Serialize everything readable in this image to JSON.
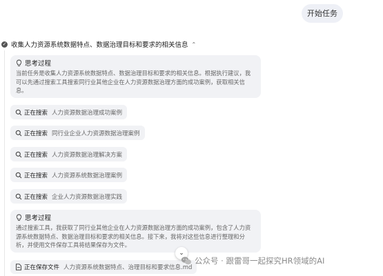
{
  "user_message": "开始任务",
  "task": {
    "title": "收集人力资源系统数据特点、数据治理目标和要求的相关信息"
  },
  "thinking_label": "思考过程",
  "thoughts": [
    "当前任务是收集人力资源系统数据特点、数据治理目标和要求的相关信息。根据执行建议，我可以先通过搜索工具搜索同行业其他企业在人力资源数据治理方面的成功案例，获取相关信息。",
    "通过搜索工具，我获取了同行业其他企业在人力资源数据治理方面的成功案例，包含了人力资源系统数据特点、数据治理目标和要求的相关信息。接下来，我将对这些信息进行整理和分析，并使用文件保存工具将结果保存为文件。"
  ],
  "searching_label": "正在搜索",
  "searches": [
    "人力资源数据治理成功案例",
    "同行业企业人力资源数据治理案例",
    "人力资源数据治理解决方案",
    "人力资源系统数据治理案例",
    "企业人力资源数据治理实践"
  ],
  "file_action": {
    "label": "正在保存文件",
    "filename": "人力资源系统数据特点、治理目标和要求信息.md"
  },
  "watermark": "公众号 · 跟雷哥一起探究HR领域的AI",
  "icons": {
    "check": "check-circle-icon",
    "collapse": "chevron-up-icon",
    "bulb": "lightbulb-icon",
    "search": "search-icon",
    "file": "file-icon",
    "scroll": "chevron-down-icon",
    "wechat": "wechat-icon"
  }
}
